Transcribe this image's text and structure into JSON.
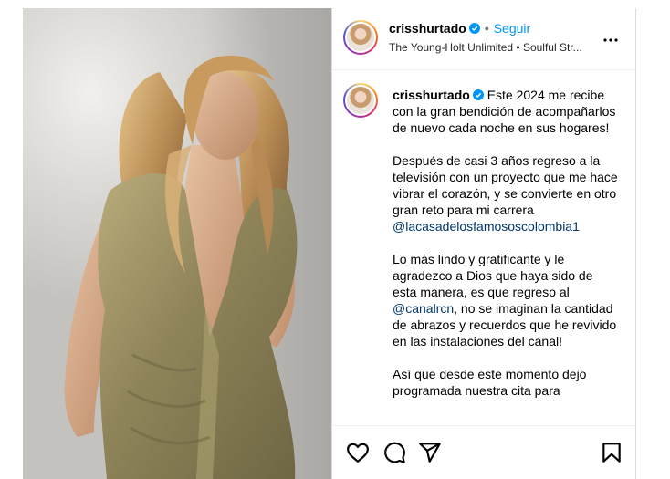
{
  "post": {
    "username": "crisshurtado",
    "follow_label": "Seguir",
    "audio": "The Young-Holt Unlimited • Soulful Str...",
    "caption_username": "crisshurtado",
    "caption": {
      "intro": "Este 2024 me recibe con la gran bendición de acompañarlos de nuevo cada noche en sus hogares!",
      "p2_text": "Después de casi 3 años regreso a la televisión con un proyecto que me hace vibrar el corazón, y se convierte en otro gran reto para mi carrera",
      "p2_mention": "@lacasadelosfamososcolombia1",
      "p3_start": "Lo más lindo y gratificante y le agradezco a Dios que haya sido de esta manera, es que regreso al",
      "p3_mention": "@canalrcn",
      "p3_end": ", no se imaginan la cantidad de abrazos y recuerdos que he revivido en las instalaciones del canal!",
      "p4_text": "Así que desde este momento dejo programada nuestra cita para"
    }
  },
  "icons": {
    "verified": "verified-badge-icon",
    "more": "more-options-icon",
    "like": "heart-icon",
    "comment": "comment-icon",
    "share": "share-icon",
    "save": "bookmark-icon"
  },
  "colors": {
    "link_blue": "#0095f6",
    "mention": "#00376b",
    "border": "#dbdbdb"
  }
}
